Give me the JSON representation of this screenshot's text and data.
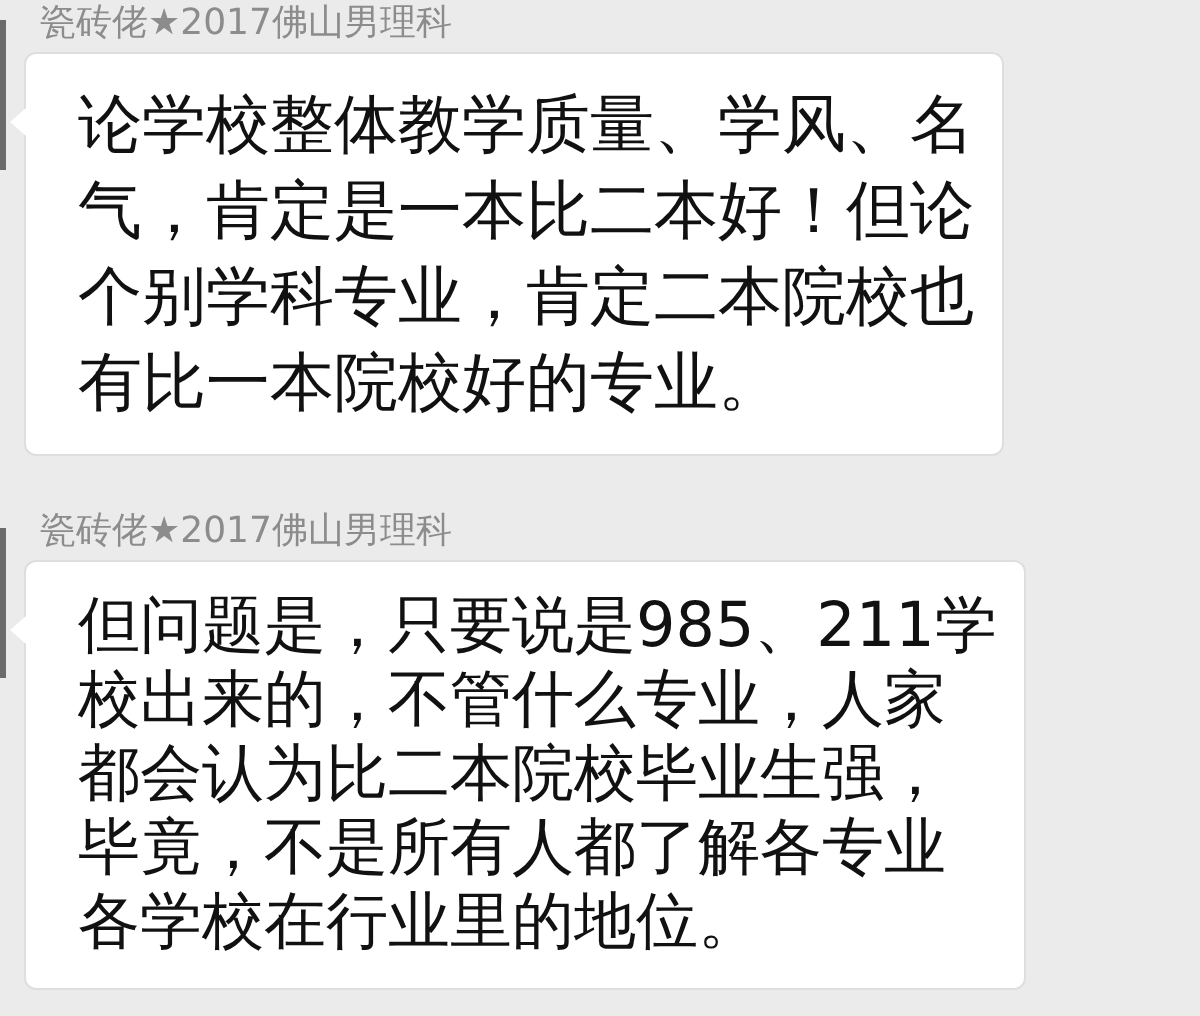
{
  "messages": [
    {
      "sender": "瓷砖佬★2017佛山男理科",
      "lines": [
        "论学校整体教学质量、学风、名",
        "气，肯定是一本比二本好！但论",
        "个别学科专业，肯定二本院校也",
        "有比一本院校好的专业。"
      ]
    },
    {
      "sender": "瓷砖佬★2017佛山男理科",
      "lines": [
        "但问题是，只要说是985、211学",
        "校出来的，不管什么专业，人家",
        "都会认为比二本院校毕业生强，",
        "毕竟，不是所有人都了解各专业",
        "各学校在行业里的地位。"
      ]
    }
  ]
}
